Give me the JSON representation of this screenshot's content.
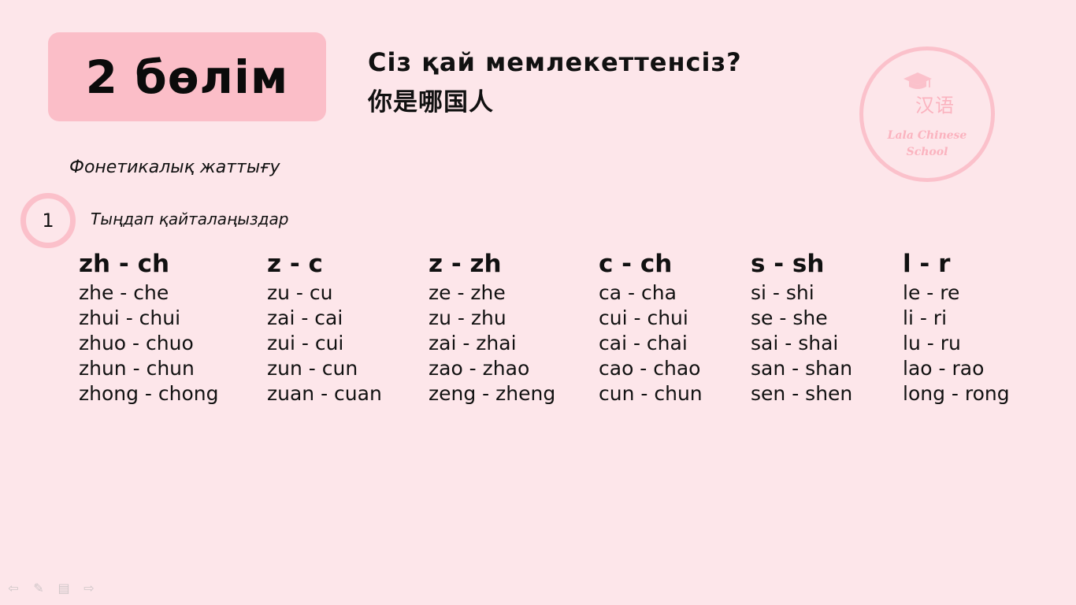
{
  "section": {
    "title": "2 бөлім"
  },
  "lesson": {
    "title_kz": "Сіз қай мемлекеттенсіз?",
    "title_zh": "你是哪国人"
  },
  "logo": {
    "chinese": "汉语",
    "name_line1": "Lala Chinese",
    "name_line2": "School"
  },
  "exercise": {
    "heading": "Фонетикалық жаттығу",
    "number": "1",
    "instruction": "Тыңдап қайталаңыздар"
  },
  "columns": [
    {
      "header": "zh - ch",
      "items": [
        "zhe - che",
        "zhui - chui",
        "zhuo - chuo",
        "zhun - chun",
        "zhong - chong"
      ]
    },
    {
      "header": "z - c",
      "items": [
        "zu - cu",
        "zai - cai",
        "zui - cui",
        "zun - cun",
        "zuan - cuan"
      ]
    },
    {
      "header": "z - zh",
      "items": [
        "ze - zhe",
        "zu - zhu",
        "zai - zhai",
        "zao - zhao",
        "zeng - zheng"
      ]
    },
    {
      "header": "c - ch",
      "items": [
        "ca - cha",
        "cui - chui",
        "cai - chai",
        "cao - chao",
        "cun - chun"
      ]
    },
    {
      "header": "s - sh",
      "items": [
        "si - shi",
        "se - she",
        "sai - shai",
        "san - shan",
        "sen - shen"
      ]
    },
    {
      "header": "l - r",
      "items": [
        "le - re",
        "li - ri",
        "lu - ru",
        "lao - rao",
        "long - rong"
      ]
    }
  ],
  "controls": {
    "icons": [
      "arrow-left-icon",
      "pen-icon",
      "menu-icon",
      "arrow-right-icon"
    ],
    "color": "#cfc6c8"
  },
  "colors": {
    "background": "#fde6ea",
    "accent": "#fbbec8"
  }
}
